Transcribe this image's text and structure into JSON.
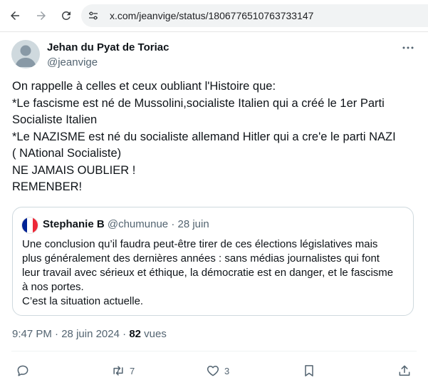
{
  "browser": {
    "url": "x.com/jeanvige/status/1806776510763733147",
    "back_icon": "arrow-left-icon",
    "forward_icon": "arrow-right-icon",
    "reload_icon": "reload-icon",
    "site_info_icon": "tune-icon"
  },
  "tweet": {
    "author_name": "Jehan du Pyat de Toriac",
    "author_handle": "@jeanvige",
    "text_lines": [
      "On rappelle à celles et ceux oubliant l'Histoire que:",
      "*Le fascisme est né de Mussolini,socialiste Italien  qui a créé le 1er Parti",
      "Socialiste Italien",
      "*Le NAZISME est né du socialiste allemand  Hitler qui a cre'e le parti NAZI",
      "( NAtional Socialiste)",
      "NE JAMAIS OUBLIER !",
      "REMENBER!"
    ],
    "quote": {
      "name": "Stephanie B",
      "handle": "@chumunue",
      "separator": "·",
      "date": "28 juin",
      "flag_colors": [
        "#002395",
        "#ffffff",
        "#ed2939"
      ],
      "text_lines": [
        "Une conclusion qu’il faudra peut-être tirer de ces élections législatives mais",
        "plus généralement des dernières années : sans médias journalistes qui font",
        "leur travail avec sérieux et éthique, la démocratie est en danger, et le fascisme",
        "à nos portes.",
        "C’est la situation actuelle."
      ]
    },
    "meta": {
      "time": "9:47 PM",
      "separator": "·",
      "date": "28 juin 2024",
      "views_count": "82",
      "views_label": "vues"
    },
    "actions": {
      "reply_count": "",
      "retweet_count": "7",
      "like_count": "3"
    }
  },
  "colors": {
    "text_primary": "#0f1419",
    "text_secondary": "#536471",
    "border": "#cfd9de"
  }
}
